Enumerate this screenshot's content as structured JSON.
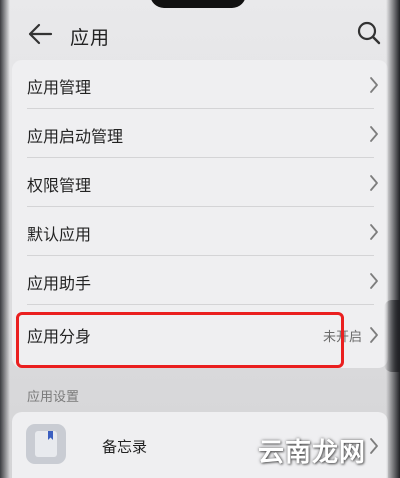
{
  "header": {
    "title": "应用"
  },
  "settings_list": [
    {
      "label": "应用管理",
      "value": ""
    },
    {
      "label": "应用启动管理",
      "value": ""
    },
    {
      "label": "权限管理",
      "value": ""
    },
    {
      "label": "默认应用",
      "value": ""
    },
    {
      "label": "应用助手",
      "value": ""
    },
    {
      "label": "应用分身",
      "value": "未开启"
    }
  ],
  "section": {
    "title": "应用设置"
  },
  "apps": [
    {
      "name": "备忘录",
      "icon": "memo-app-icon"
    }
  ],
  "watermark": "云南龙网",
  "colors": {
    "highlight": "#ea1f1f",
    "background": "#e4e4e6",
    "card": "#efeff1"
  }
}
